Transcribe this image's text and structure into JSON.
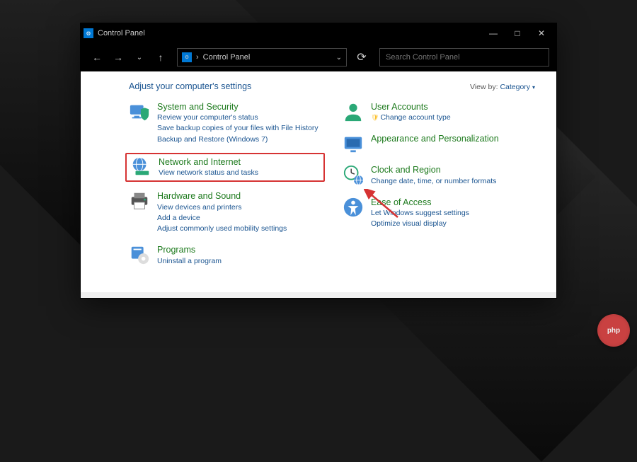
{
  "window": {
    "title": "Control Panel",
    "minimize": "—",
    "maximize": "□",
    "close": "✕"
  },
  "nav": {
    "back": "←",
    "forward": "→",
    "recent": "⌄",
    "up": "↑",
    "addr_sep": "›",
    "address": "Control Panel",
    "addr_dropdown": "⌄",
    "refresh": "⟳"
  },
  "search": {
    "placeholder": "Search Control Panel"
  },
  "heading": "Adjust your computer's settings",
  "viewby": {
    "label": "View by:",
    "value": "Category",
    "caret": "▾"
  },
  "left": [
    {
      "icon": "shield-pc-icon",
      "title": "System and Security",
      "links": [
        "Review your computer's status",
        "Save backup copies of your files with File History",
        "Backup and Restore (Windows 7)"
      ]
    },
    {
      "icon": "globe-network-icon",
      "title": "Network and Internet",
      "links": [
        "View network status and tasks"
      ],
      "highlighted": true
    },
    {
      "icon": "printer-icon",
      "title": "Hardware and Sound",
      "links": [
        "View devices and printers",
        "Add a device",
        "Adjust commonly used mobility settings"
      ]
    },
    {
      "icon": "programs-icon",
      "title": "Programs",
      "links": [
        "Uninstall a program"
      ]
    }
  ],
  "right": [
    {
      "icon": "user-icon",
      "title": "User Accounts",
      "links": [
        "Change account type"
      ],
      "shield": true
    },
    {
      "icon": "personalization-icon",
      "title": "Appearance and Personalization",
      "links": []
    },
    {
      "icon": "clock-region-icon",
      "title": "Clock and Region",
      "links": [
        "Change date, time, or number formats"
      ]
    },
    {
      "icon": "ease-access-icon",
      "title": "Ease of Access",
      "links": [
        "Let Windows suggest settings",
        "Optimize visual display"
      ]
    }
  ],
  "watermark": "php"
}
